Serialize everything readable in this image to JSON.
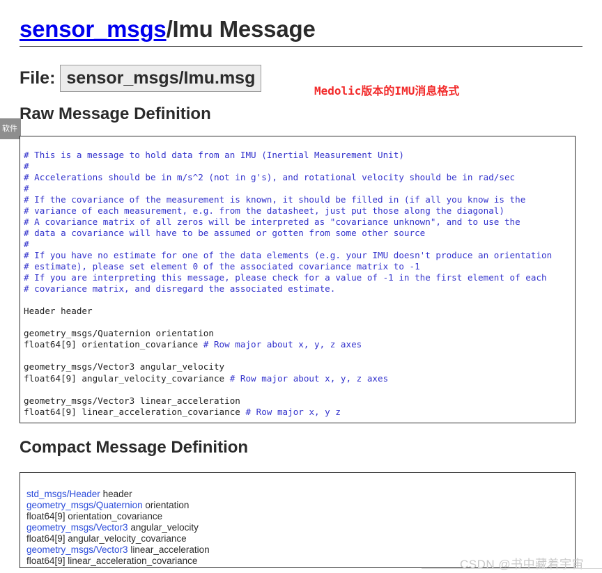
{
  "title": {
    "link_text": "sensor_msgs",
    "rest_text": "/Imu Message"
  },
  "file": {
    "label": "File:",
    "value": "sensor_msgs/Imu.msg"
  },
  "annotation": {
    "text": "Medolic版本的IMU消息格式",
    "color": "#f22a2a"
  },
  "left_tab": {
    "label": "软件"
  },
  "sections": {
    "raw_heading": "Raw Message Definition",
    "compact_heading": "Compact Message Definition"
  },
  "raw_definition": {
    "lines": [
      {
        "comment": "# This is a message to hold data from an IMU (Inertial Measurement Unit)",
        "code": ""
      },
      {
        "comment": "#",
        "code": ""
      },
      {
        "comment": "# Accelerations should be in m/s^2 (not in g's), and rotational velocity should be in rad/sec",
        "code": ""
      },
      {
        "comment": "#",
        "code": ""
      },
      {
        "comment": "# If the covariance of the measurement is known, it should be filled in (if all you know is the",
        "code": ""
      },
      {
        "comment": "# variance of each measurement, e.g. from the datasheet, just put those along the diagonal)",
        "code": ""
      },
      {
        "comment": "# A covariance matrix of all zeros will be interpreted as \"covariance unknown\", and to use the",
        "code": ""
      },
      {
        "comment": "# data a covariance will have to be assumed or gotten from some other source",
        "code": ""
      },
      {
        "comment": "#",
        "code": ""
      },
      {
        "comment": "# If you have no estimate for one of the data elements (e.g. your IMU doesn't produce an orientation",
        "code": ""
      },
      {
        "comment": "# estimate), please set element 0 of the associated covariance matrix to -1",
        "code": ""
      },
      {
        "comment": "# If you are interpreting this message, please check for a value of -1 in the first element of each",
        "code": ""
      },
      {
        "comment": "# covariance matrix, and disregard the associated estimate.",
        "code": ""
      },
      {
        "comment": "",
        "code": ""
      },
      {
        "comment": "",
        "code": "Header header"
      },
      {
        "comment": "",
        "code": ""
      },
      {
        "comment": "",
        "code": "geometry_msgs/Quaternion orientation"
      },
      {
        "comment": "# Row major about x, y, z axes",
        "code": "float64[9] orientation_covariance "
      },
      {
        "comment": "",
        "code": ""
      },
      {
        "comment": "",
        "code": "geometry_msgs/Vector3 angular_velocity"
      },
      {
        "comment": "# Row major about x, y, z axes",
        "code": "float64[9] angular_velocity_covariance "
      },
      {
        "comment": "",
        "code": ""
      },
      {
        "comment": "",
        "code": "geometry_msgs/Vector3 linear_acceleration"
      },
      {
        "comment": "# Row major x, y z",
        "code": "float64[9] linear_acceleration_covariance "
      }
    ]
  },
  "compact_definition": {
    "lines": [
      {
        "type_link": "std_msgs/Header",
        "field": " header"
      },
      {
        "type_link": "geometry_msgs/Quaternion",
        "field": " orientation"
      },
      {
        "type_link": "",
        "field": "float64[9] orientation_covariance"
      },
      {
        "type_link": "geometry_msgs/Vector3",
        "field": " angular_velocity"
      },
      {
        "type_link": "",
        "field": "float64[9] angular_velocity_covariance"
      },
      {
        "type_link": "geometry_msgs/Vector3",
        "field": " linear_acceleration"
      },
      {
        "type_link": "",
        "field": "float64[9] linear_acceleration_covariance"
      }
    ]
  },
  "watermark": {
    "text": "CSDN @书中藏着宇宙"
  }
}
